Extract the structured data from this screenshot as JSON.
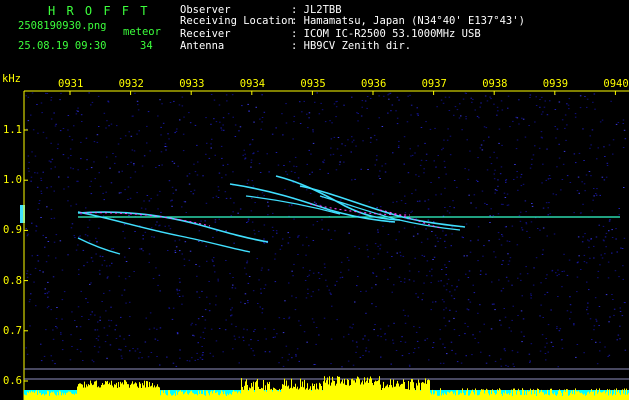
{
  "app": {
    "name": "HROFFT",
    "name_spaced": "H R O F F T"
  },
  "file": {
    "filename": "2508190930.png",
    "datetime": "25.08.19 09:30",
    "count_label": "meteor",
    "count_value": "34"
  },
  "station": {
    "rows": [
      {
        "label": "Observer",
        "value": ": JL2TBB"
      },
      {
        "label": "Receiving Location",
        "value": ": Hamamatsu, Japan (N34°40' E137°43')"
      },
      {
        "label": "Receiver",
        "value": ": ICOM IC-R2500 53.1000MHz USB"
      },
      {
        "label": "Antenna",
        "value": ": HB9CV Zenith dir."
      }
    ]
  },
  "axes": {
    "y_unit": "kHz",
    "time_ticks": [
      "0931",
      "0932",
      "0933",
      "0934",
      "0935",
      "0936",
      "0937",
      "0938",
      "0939",
      "0940"
    ],
    "freq_ticks": [
      "1.1",
      "1.0",
      "0.9",
      "0.8",
      "0.7",
      "0.6"
    ]
  },
  "colors": {
    "text_green": "#3cff3c",
    "text_white": "#ffffff",
    "axis_yellow": "#ffff00",
    "echo_cyan": "#40e0ff",
    "carrier_cyan": "#33ffcc",
    "echo_magenta": "#ff44ff",
    "noise_blue": "#1a1aa0",
    "level_yellow": "#ffff00",
    "level_cyan": "#00ffff"
  }
}
